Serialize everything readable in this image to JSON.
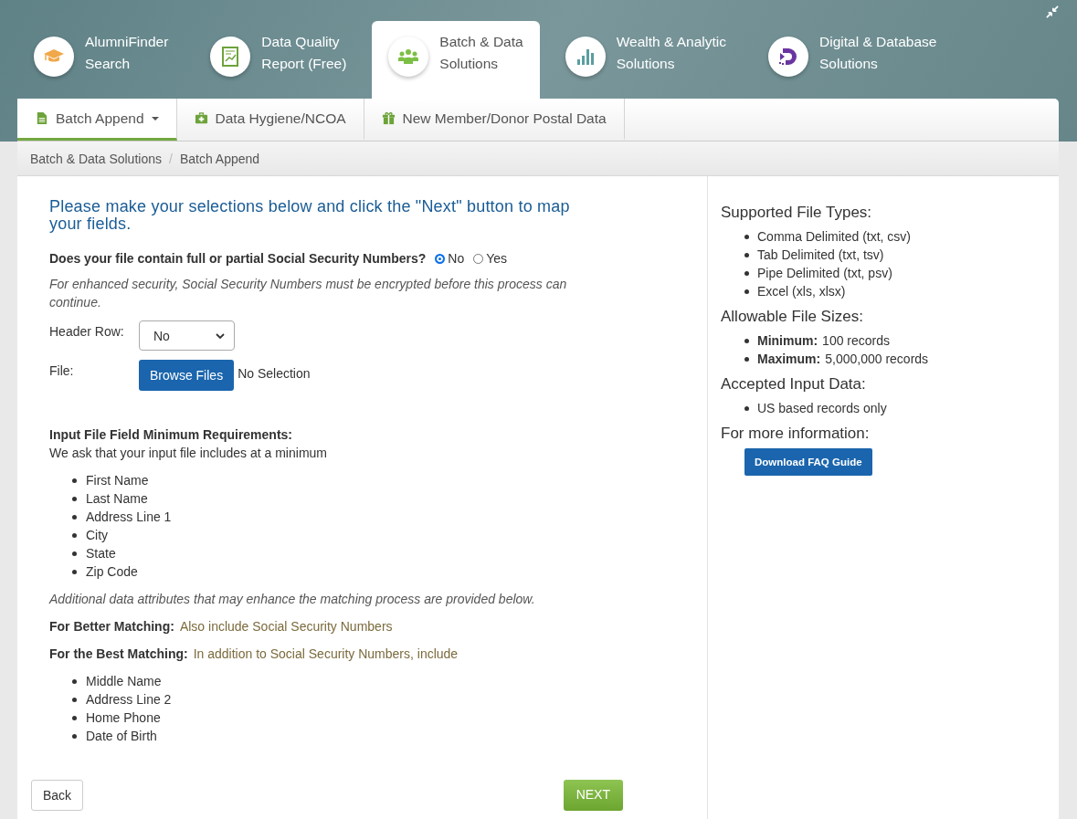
{
  "nav": [
    {
      "label_lines": [
        "AlumniFinder",
        "Search"
      ],
      "selected": false
    },
    {
      "label_lines": [
        "Data Quality",
        "Report (Free)"
      ],
      "selected": false
    },
    {
      "label_lines": [
        "Batch & Data",
        "Solutions"
      ],
      "selected": true
    },
    {
      "label_lines": [
        "Wealth & Analytic",
        "Solutions"
      ],
      "selected": false
    },
    {
      "label_lines": [
        "Digital & Database",
        "Solutions"
      ],
      "selected": false
    }
  ],
  "sub_tabs": [
    {
      "label": "Batch Append",
      "selected": true,
      "has_menu": true
    },
    {
      "label": "Data Hygiene/NCOA",
      "selected": false,
      "has_menu": false
    },
    {
      "label": "New Member/Donor Postal Data",
      "selected": false,
      "has_menu": false
    }
  ],
  "breadcrumb": {
    "items": [
      "Batch & Data Solutions",
      "Batch Append"
    ],
    "separator": "/"
  },
  "form": {
    "heading": "Please make your selections below and click the \"Next\" button to map your fields.",
    "ssn_question": "Does your file contain full or partial Social Security Numbers?",
    "ssn_options": [
      {
        "label": "No",
        "selected": true
      },
      {
        "label": "Yes",
        "selected": false
      }
    ],
    "ssn_note": "For enhanced security, Social Security Numbers must be encrypted before this process can continue.",
    "header_row": {
      "label": "Header Row:",
      "value": "No"
    },
    "file": {
      "label": "File:",
      "button": "Browse Files",
      "status": "No Selection"
    },
    "requirements_heading": "Input File Field Minimum Requirements:",
    "requirements_intro": "We ask that your input file includes at a minimum",
    "required_fields": [
      "First Name",
      "Last Name",
      "Address Line 1",
      "City",
      "State",
      "Zip Code"
    ],
    "additional_note": "Additional data attributes that may enhance the matching process are provided below.",
    "better_matching": {
      "label": "For Better Matching:",
      "text": "Also include Social Security Numbers"
    },
    "best_matching": {
      "label": "For the Best Matching:",
      "text": "In addition to Social Security Numbers, include"
    },
    "best_fields": [
      "Middle Name",
      "Address Line 2",
      "Home Phone",
      "Date of Birth"
    ],
    "back_button": "Back",
    "next_button": "NEXT"
  },
  "info": [
    {
      "heading": "Supported File Types:",
      "items": [
        {
          "text": "Comma Delimited (txt, csv)"
        },
        {
          "text": "Tab Delimited (txt, tsv)"
        },
        {
          "text": "Pipe Delimited (txt, psv)"
        },
        {
          "text": "Excel (xls, xlsx)"
        }
      ]
    },
    {
      "heading": "Allowable File Sizes:",
      "items": [
        {
          "label": "Minimum:",
          "text": "100 records"
        },
        {
          "label": "Maximum:",
          "text": "5,000,000 records"
        }
      ]
    },
    {
      "heading": "Accepted Input Data:",
      "items": [
        {
          "text": "US based records only"
        }
      ]
    },
    {
      "heading": "For more information:",
      "button": "Download FAQ Guide"
    }
  ]
}
